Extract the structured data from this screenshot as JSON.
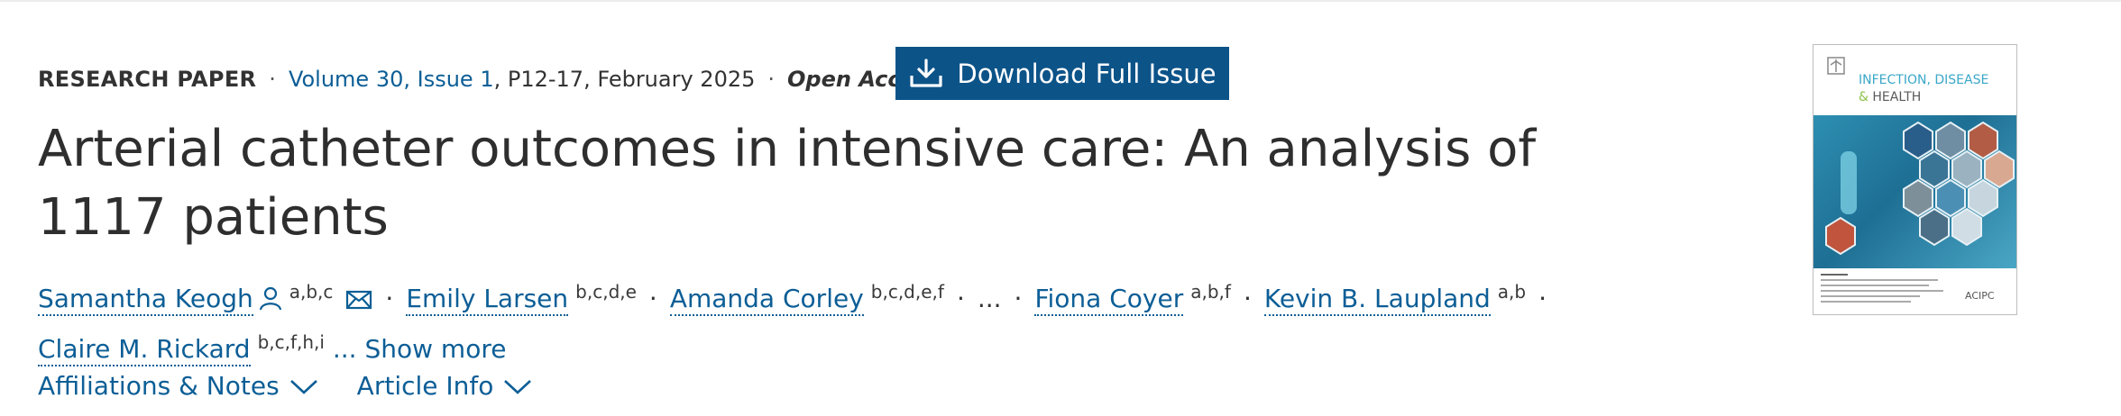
{
  "article_type": "RESEARCH PAPER",
  "separator": "·",
  "issue_link": "Volume 30, Issue 1",
  "pages_date": ", P12-17, February 2025",
  "open_access": "Open Access",
  "download_button": "Download Full Issue",
  "title": "Arterial catheter outcomes in intensive care: An analysis of 1117 patients",
  "authors": [
    {
      "name": "Samantha Keogh",
      "affil": "a,b,c"
    },
    {
      "name": "Emily Larsen",
      "affil": "b,c,d,e"
    },
    {
      "name": "Amanda Corley",
      "affil": "b,c,d,e,f"
    },
    {
      "name": "Fiona Coyer",
      "affil": "a,b,f"
    },
    {
      "name": "Kevin B. Laupland",
      "affil": "a,b"
    },
    {
      "name": "Claire M. Rickard",
      "affil": "b,c,f,h,i"
    }
  ],
  "ellipsis": "...",
  "show_more": "... Show more",
  "toggles": {
    "affiliations": "Affiliations & Notes",
    "article_info": "Article Info"
  },
  "cover": {
    "line1": "INFECTION, DISEASE",
    "line2_amp": "&",
    "line2": "HEALTH",
    "logo": "ACIPC"
  },
  "colors": {
    "link": "#0c5e96",
    "button_bg": "#0c5388",
    "text": "#2e2e2e"
  },
  "icons": [
    "person-icon",
    "envelope-icon",
    "download-icon",
    "chevron-down-icon"
  ]
}
